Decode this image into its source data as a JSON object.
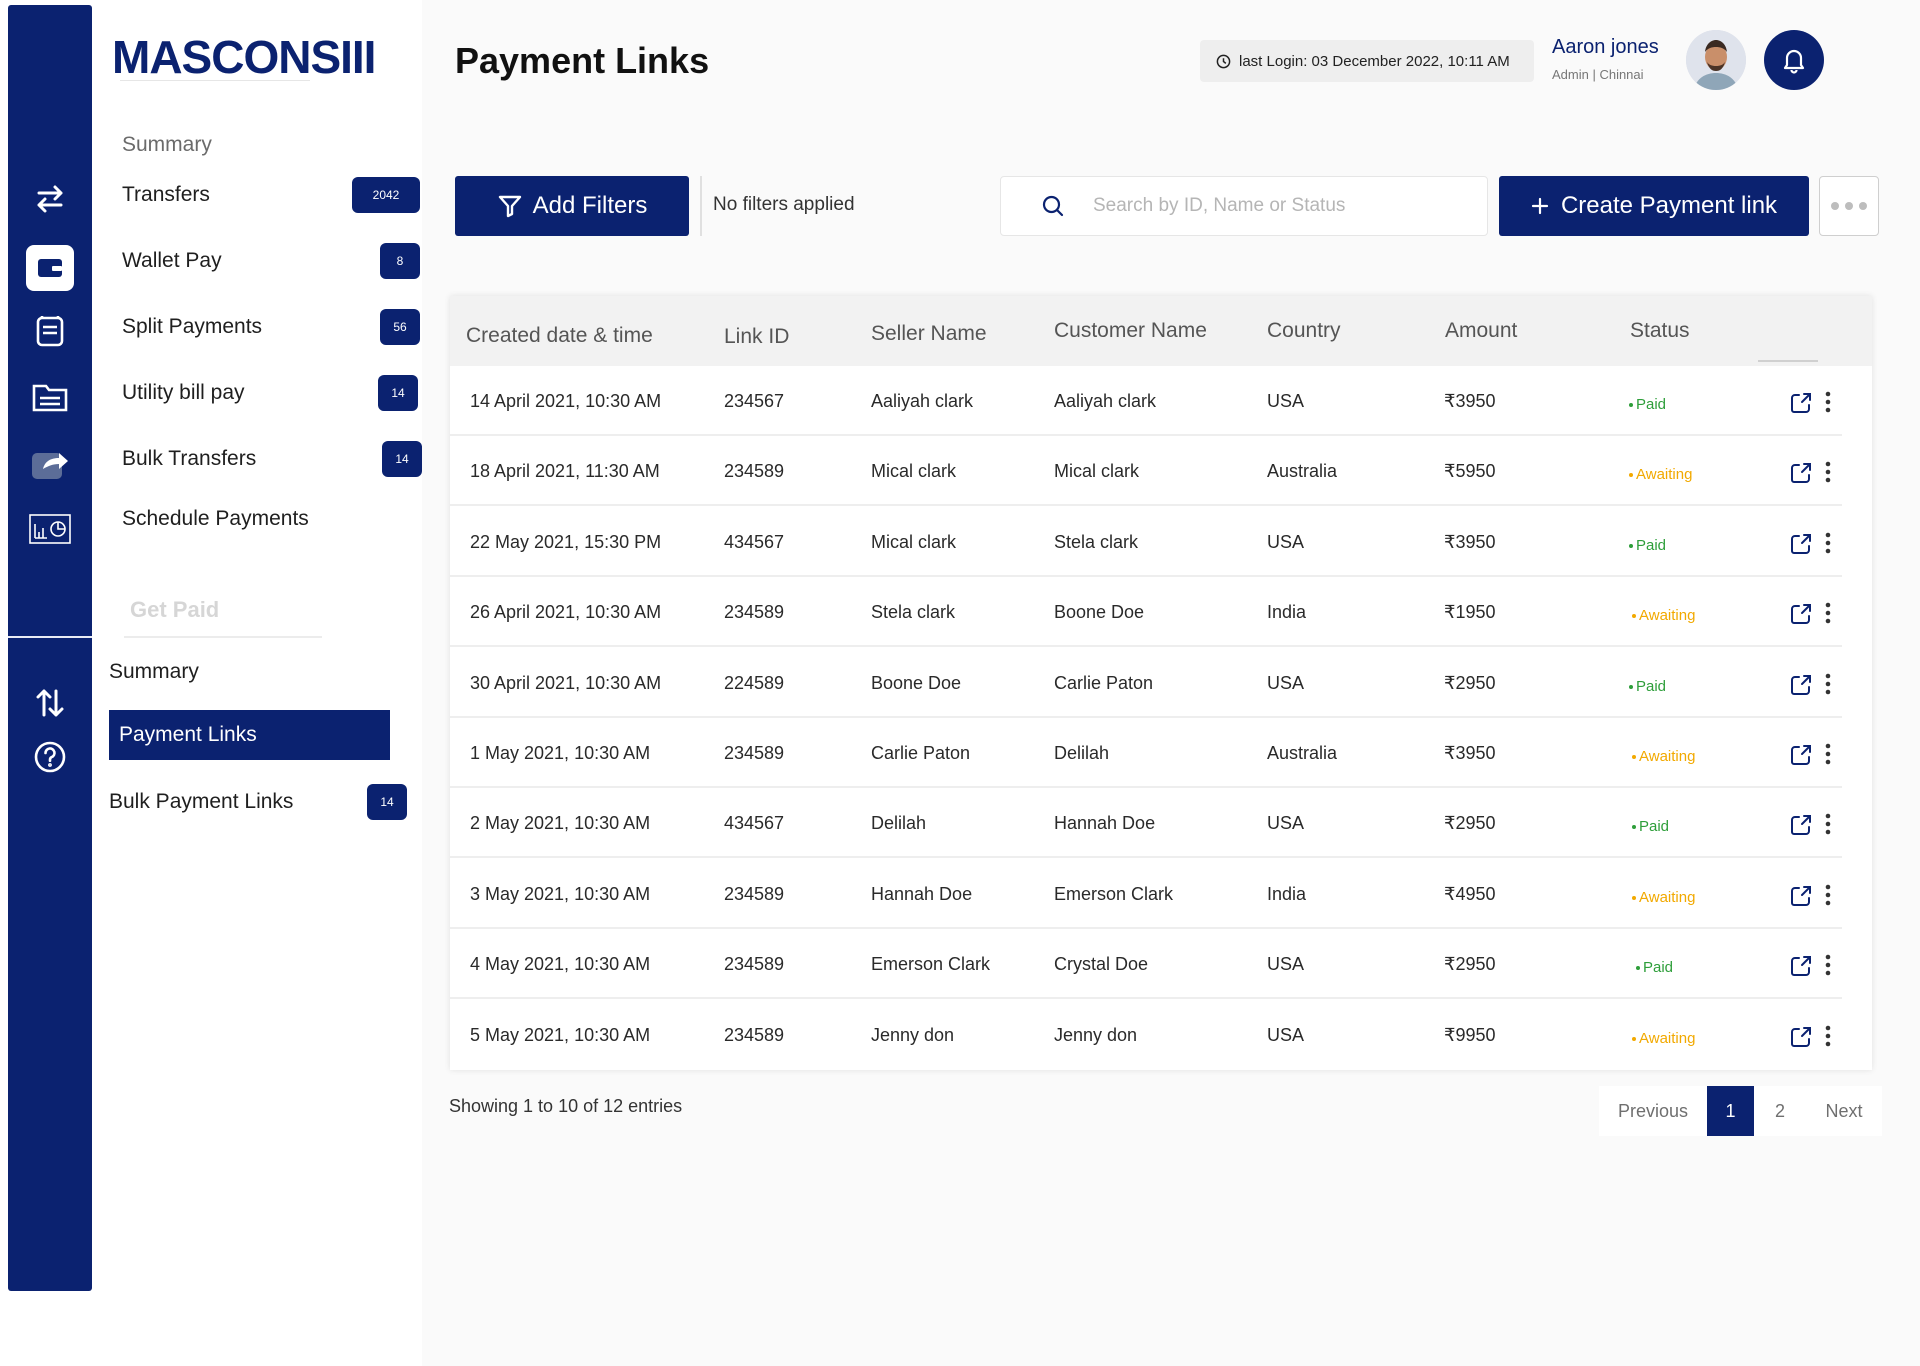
{
  "app": {
    "logo": "MASCONSIII"
  },
  "sidebar": {
    "section_summary": "Summary",
    "items": [
      {
        "label": "Transfers",
        "badge": "2042"
      },
      {
        "label": "Wallet Pay",
        "badge": "8"
      },
      {
        "label": "Split Payments",
        "badge": "56"
      },
      {
        "label": "Utility bill pay",
        "badge": "14"
      },
      {
        "label": "Bulk Transfers",
        "badge": "14"
      },
      {
        "label": "Schedule Payments",
        "badge": ""
      }
    ],
    "get_paid": "Get Paid",
    "gp_summary": "Summary",
    "gp_active": "Payment Links",
    "gp_bulk": "Bulk Payment Links",
    "gp_bulk_badge": "14"
  },
  "header": {
    "title": "Payment Links",
    "last_login": "last Login: 03 December 2022, 10:11 AM",
    "user_name": "Aaron jones",
    "user_role": "Admin | Chinnai"
  },
  "toolbar": {
    "add_filters": "Add Filters",
    "no_filters": "No filters applied",
    "search_placeholder": "Search by ID, Name or Status",
    "create_label": "Create Payment link"
  },
  "table": {
    "columns": [
      "Created date & time",
      "Link ID",
      "Seller Name",
      "Customer Name",
      "Country",
      "Amount",
      "Status"
    ],
    "rows": [
      [
        "14 April 2021, 10:30 AM",
        "234567",
        "Aaliyah clark",
        "Aaliyah clark",
        "USA",
        "₹3950",
        "Paid"
      ],
      [
        "18 April 2021, 11:30 AM",
        "234589",
        "Mical clark",
        "Mical clark",
        "Australia",
        "₹5950",
        "Awaiting"
      ],
      [
        "22 May 2021, 15:30 PM",
        "434567",
        "Mical clark",
        "Stela clark",
        "USA",
        "₹3950",
        "Paid"
      ],
      [
        "26 April 2021, 10:30 AM",
        "234589",
        "Stela clark",
        "Boone Doe",
        "India",
        "₹1950",
        "Awaiting"
      ],
      [
        "30 April 2021, 10:30 AM",
        "224589",
        "Boone Doe",
        "Carlie Paton",
        "USA",
        "₹2950",
        "Paid"
      ],
      [
        "1 May 2021, 10:30 AM",
        "234589",
        "Carlie Paton",
        "Delilah",
        "Australia",
        "₹3950",
        "Awaiting"
      ],
      [
        "2 May 2021, 10:30 AM",
        "434567",
        "Delilah",
        "Hannah Doe",
        "USA",
        "₹2950",
        "Paid"
      ],
      [
        "3 May 2021, 10:30 AM",
        "234589",
        "Hannah Doe",
        "Emerson Clark",
        "India",
        "₹4950",
        "Awaiting"
      ],
      [
        "4 May 2021, 10:30 AM",
        "234589",
        "Emerson Clark",
        "Crystal Doe",
        "USA",
        "₹2950",
        "Paid"
      ],
      [
        "5 May 2021, 10:30 AM",
        "234589",
        "Jenny don",
        "Jenny don",
        "USA",
        "₹9950",
        "Awaiting"
      ]
    ]
  },
  "status_colors": {
    "Paid": "#2e9e3a",
    "Awaiting": "#f2a900"
  },
  "footer": {
    "showing": "Showing 1 to 10 of 12 entries",
    "previous": "Previous",
    "page1": "1",
    "page2": "2",
    "next": "Next"
  },
  "colors": {
    "brand": "#0b2270"
  },
  "icons": {
    "rail": [
      "transfer-arrows-icon",
      "wallet-icon",
      "bill-icon",
      "folder-icon",
      "share-icon",
      "dashboard-icon",
      "sort-arrows-icon",
      "help-icon"
    ],
    "row_actions": [
      "share-link-icon",
      "more-vertical-icon"
    ]
  }
}
